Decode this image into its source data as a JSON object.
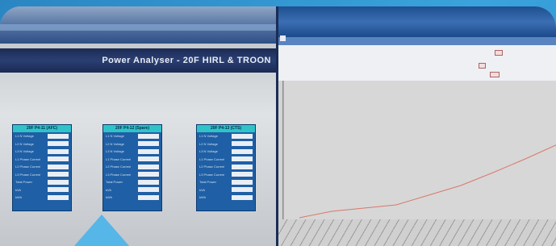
{
  "left_screen": {
    "title": "Power Analyser  -  20F HIRL & TROON",
    "panels": [
      {
        "header": "20F P4-11 (AFC)",
        "rows": [
          "L1 N Voltage",
          "L2 N Voltage",
          "L3 N Voltage",
          "L1 Phase Current",
          "L2 Phase Current",
          "L3 Phase Current",
          "Total Power",
          "kVA",
          "kWh"
        ]
      },
      {
        "header": "20F P4-12 (Spare)",
        "rows": [
          "L1 N Voltage",
          "L2 N Voltage",
          "L3 N Voltage",
          "L1 Phase Current",
          "L2 Phase Current",
          "L3 Phase Current",
          "Total Power",
          "kVA",
          "kWh"
        ]
      },
      {
        "header": "20F P4-13 (CTS)",
        "rows": [
          "L1 N Voltage",
          "L2 N Voltage",
          "L3 N Voltage",
          "L1 Phase Current",
          "L2 Phase Current",
          "L3 Phase Current",
          "Total Power",
          "kVA",
          "kWh"
        ]
      }
    ]
  },
  "right_screen": {
    "chart_line_color": "#e07060"
  },
  "colors": {
    "accent": "#56b6e8",
    "title_bar": "#1c2b54"
  }
}
